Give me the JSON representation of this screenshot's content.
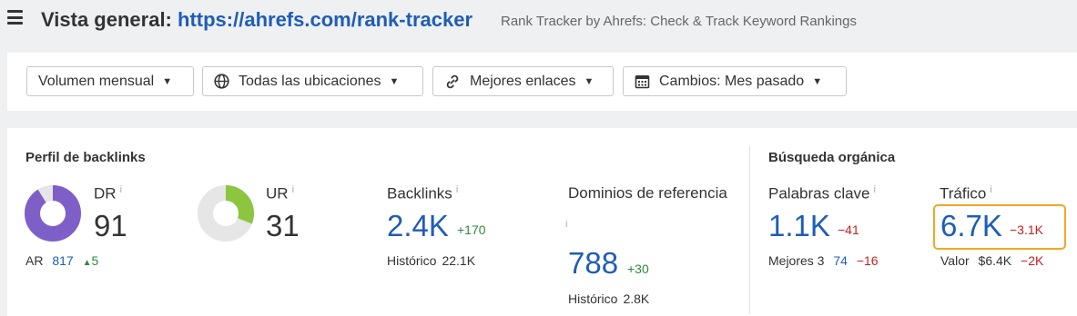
{
  "header": {
    "title_prefix": "Vista general:",
    "url": "https://ahrefs.com/rank-tracker",
    "subtitle": "Rank Tracker by Ahrefs: Check & Track Keyword Rankings"
  },
  "filters": [
    {
      "label": "Volumen mensual",
      "icon": "none"
    },
    {
      "label": "Todas las ubicaciones",
      "icon": "globe-icon"
    },
    {
      "label": "Mejores enlaces",
      "icon": "link-icon"
    },
    {
      "label": "Cambios: Mes pasado",
      "icon": "calendar-icon"
    }
  ],
  "backlinks": {
    "section_title": "Perfil de backlinks",
    "dr": {
      "label": "DR",
      "value": "91",
      "fill_fraction": 0.91
    },
    "ar": {
      "label": "AR",
      "value": "817",
      "change": "5"
    },
    "ur": {
      "label": "UR",
      "value": "31",
      "fill_fraction": 0.31
    },
    "backlinks": {
      "label": "Backlinks",
      "value": "2.4K",
      "change": "+170",
      "history_label": "Histórico",
      "history_value": "22.1K"
    },
    "ref_domains": {
      "label": "Dominios de referencia",
      "value": "788",
      "change": "+30",
      "history_label": "Histórico",
      "history_value": "2.8K"
    }
  },
  "organic": {
    "section_title": "Búsqueda orgánica",
    "keywords": {
      "label": "Palabras clave",
      "value": "1.1K",
      "change": "−41",
      "top3_label": "Mejores 3",
      "top3_value": "74",
      "top3_change": "−16"
    },
    "traffic": {
      "label": "Tráfico",
      "value": "6.7K",
      "change": "−3.1K",
      "value_label": "Valor",
      "value_amount": "$6.4K",
      "value_change": "−2K"
    }
  },
  "colors": {
    "dr_fill": "#7e5fc7",
    "ur_fill": "#8cc63f",
    "donut_track": "#e6e6e6",
    "highlight": "#f5a623",
    "link_blue": "#1f5db6"
  }
}
